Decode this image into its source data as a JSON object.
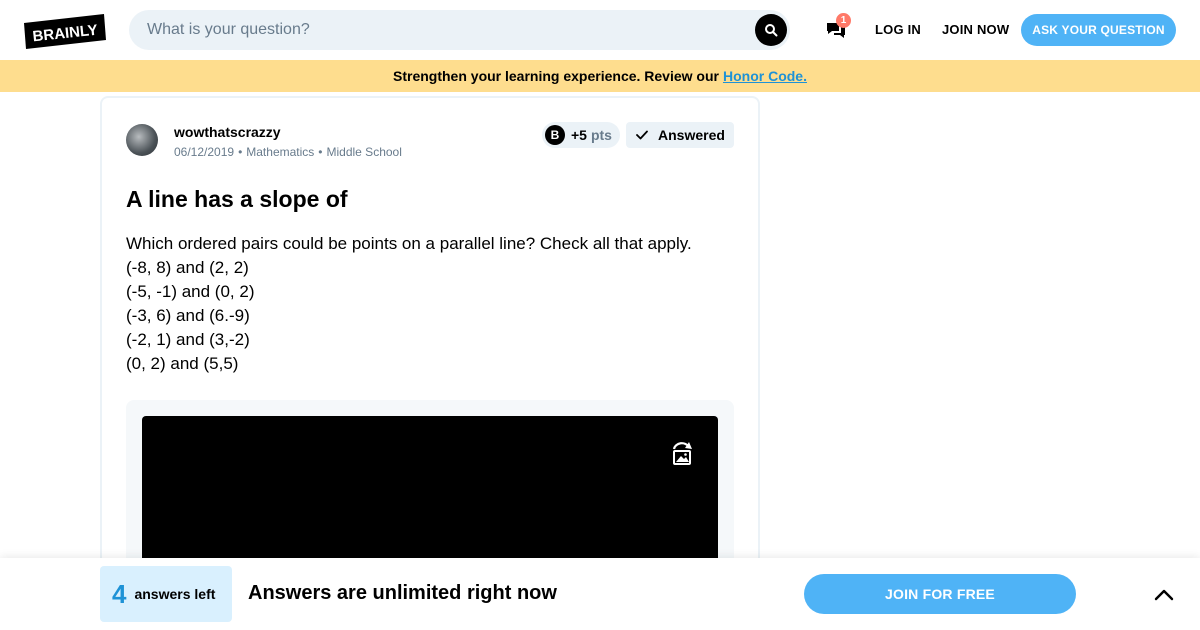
{
  "header": {
    "logo_text": "BRAINLY",
    "search_placeholder": "What is your question?",
    "messages_count": "1",
    "login_label": "LOG IN",
    "join_now_label": "JOIN NOW",
    "ask_button_label": "ASK YOUR QUESTION"
  },
  "banner": {
    "text": "Strengthen your learning experience. Review our",
    "link_text": "Honor Code."
  },
  "question": {
    "author": "wowthatscrazzy",
    "date": "06/12/2019",
    "subject": "Mathematics",
    "level": "Middle School",
    "points_value": "+5",
    "points_unit": "pts",
    "status": "Answered",
    "title": "A line has a slope of",
    "prompt": "Which ordered pairs could be points on a parallel line? Check all that apply.",
    "options": [
      "(-8, 8) and (2, 2)",
      "(-5, -1) and (0, 2)",
      "(-3, 6) and (6.-9)",
      "(-2, 1) and (3,-2)",
      "(0, 2) and (5,5)"
    ]
  },
  "bottom_bar": {
    "answers_left_count": "4",
    "answers_left_label": "answers left",
    "message": "Answers are unlimited right now",
    "join_free_label": "JOIN FOR FREE"
  },
  "colors": {
    "accent_blue": "#4fb3f6",
    "banner_yellow": "#fedd8e",
    "link_blue": "#1e92d6",
    "badge_red": "#ff7968"
  },
  "icons": {
    "search": "search-icon",
    "messages": "messages-icon",
    "check": "check-icon",
    "rotate": "rotate-image-icon",
    "chevron": "chevron-up-icon"
  }
}
